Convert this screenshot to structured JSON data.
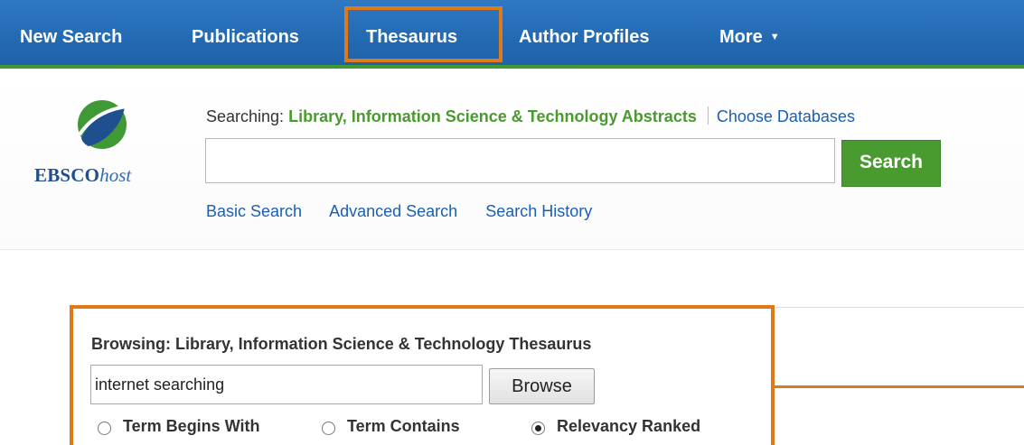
{
  "nav": {
    "items": [
      {
        "label": "New Search"
      },
      {
        "label": "Publications"
      },
      {
        "label": "Thesaurus"
      },
      {
        "label": "Author Profiles"
      },
      {
        "label": "More"
      }
    ],
    "highlighted": "Thesaurus"
  },
  "header": {
    "logo": {
      "brand": "EBSCO",
      "host": "host"
    },
    "searching_prefix": "Searching:",
    "database": "Library, Information Science & Technology Abstracts",
    "choose_databases": "Choose Databases",
    "search_input": {
      "value": "",
      "placeholder": ""
    },
    "search_button": "Search",
    "links": [
      "Basic Search",
      "Advanced Search",
      "Search History"
    ]
  },
  "browse": {
    "label": "Browsing: Library, Information Science & Technology Thesaurus",
    "input_value": "internet searching",
    "button": "Browse",
    "options": [
      {
        "label": "Term Begins With",
        "checked": false
      },
      {
        "label": "Term Contains",
        "checked": false
      },
      {
        "label": "Relevancy Ranked",
        "checked": true
      }
    ]
  },
  "colors": {
    "nav_blue": "#236ab3",
    "nav_green_rule": "#3f9a36",
    "highlight_orange": "#e07a18",
    "link_blue": "#1a5fb4",
    "db_green": "#4a9a2e",
    "search_green": "#4a9b2f"
  }
}
